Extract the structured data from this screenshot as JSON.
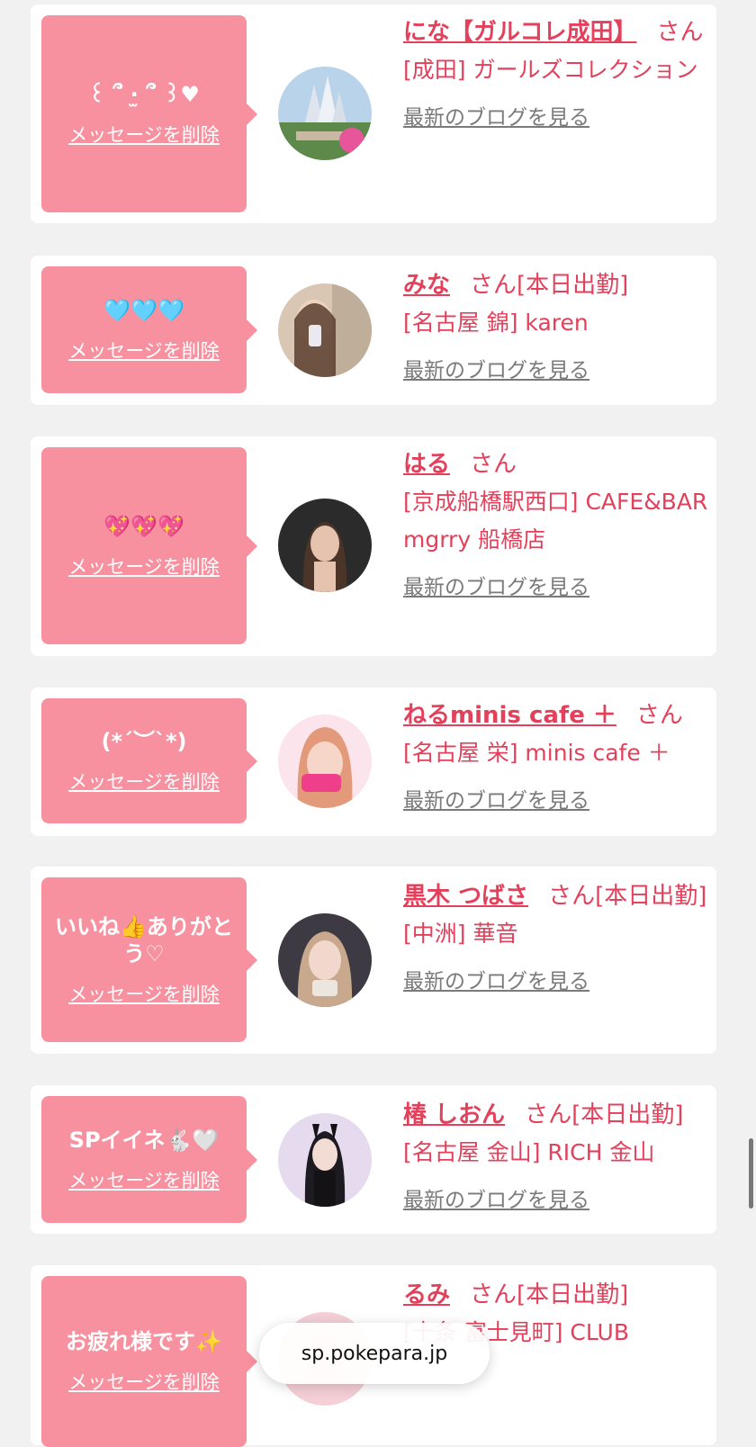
{
  "common": {
    "delete_label": "メッセージを削除",
    "san": "さん",
    "blog_label": "最新のブログを見る"
  },
  "cards": [
    {
      "message": "꒰ ՞ ·̫ ՞ ꒱♥",
      "name": "にな【ガルコレ成田】",
      "status": "",
      "shop": "[成田] ガールズコレクション",
      "avatar": "castle-photo"
    },
    {
      "message": "🩵🩵🩵",
      "name": "みな",
      "status": "[本日出勤]",
      "shop": "[名古屋 錦] karen",
      "avatar": "mirror-selfie"
    },
    {
      "message": "💖💖💖",
      "name": "はる",
      "status": "",
      "shop": "[京成船橋駅西口] CAFE&BAR mgrry 船橋店",
      "avatar": "dark-portrait"
    },
    {
      "message": "(*´︶`*)",
      "name": "ねるminis cafe ＋",
      "status": "",
      "shop": "[名古屋 栄] minis cafe ＋",
      "avatar": "pink-hair"
    },
    {
      "message": "いいね👍ありがとう♡",
      "name": "黒木 つばさ",
      "status": "[本日出勤]",
      "shop": "[中洲] 華音",
      "avatar": "blonde-portrait"
    },
    {
      "message": "SPイイネ🐇🤍",
      "name": "椿 しおん",
      "status": "[本日出勤]",
      "shop": "[名古屋 金山] RICH 金山",
      "avatar": "bunny-outfit"
    },
    {
      "message": "お疲れ様です✨",
      "name": "るみ",
      "status": "[本日出勤]",
      "shop": "[十条 富士見町] CLUB",
      "avatar": "portrait"
    }
  ],
  "browser": {
    "url": "sp.pokepara.jp"
  },
  "colors": {
    "bubble": "#f7909f",
    "accent": "#e3415b",
    "link_gray": "#7a7a7a",
    "background": "#f1f1f1"
  }
}
